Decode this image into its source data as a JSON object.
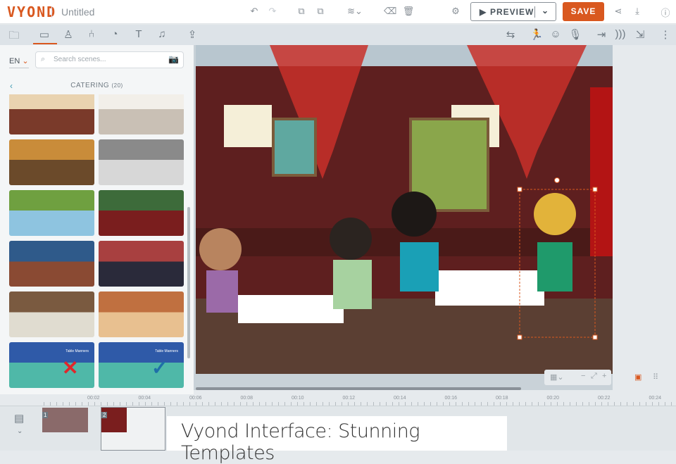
{
  "header": {
    "logo": "VYOND",
    "title": "Untitled",
    "preview_label": "PREVIEW",
    "save_label": "SAVE"
  },
  "panel": {
    "language": "EN",
    "search_placeholder": "Search scenes...",
    "category": "CATERING",
    "count": "(20)",
    "thumbnails": [
      {
        "label": ""
      },
      {
        "label": ""
      },
      {
        "label": ""
      },
      {
        "label": ""
      },
      {
        "label": ""
      },
      {
        "label": ""
      },
      {
        "label": ""
      },
      {
        "label": ""
      },
      {
        "label": ""
      },
      {
        "label": ""
      },
      {
        "label": "Table Manners"
      },
      {
        "label": "Table Manners"
      }
    ]
  },
  "timeline": {
    "ticks": [
      "00:02",
      "00:04",
      "00:06",
      "00:08",
      "00:10",
      "00:12",
      "00:14",
      "00:16",
      "00:18",
      "00:20",
      "00:22",
      "00:24"
    ],
    "scenes": [
      "1",
      "2"
    ]
  },
  "caption": "Vyond Interface: Stunning Templates",
  "colors": {
    "accent": "#d9581f"
  }
}
